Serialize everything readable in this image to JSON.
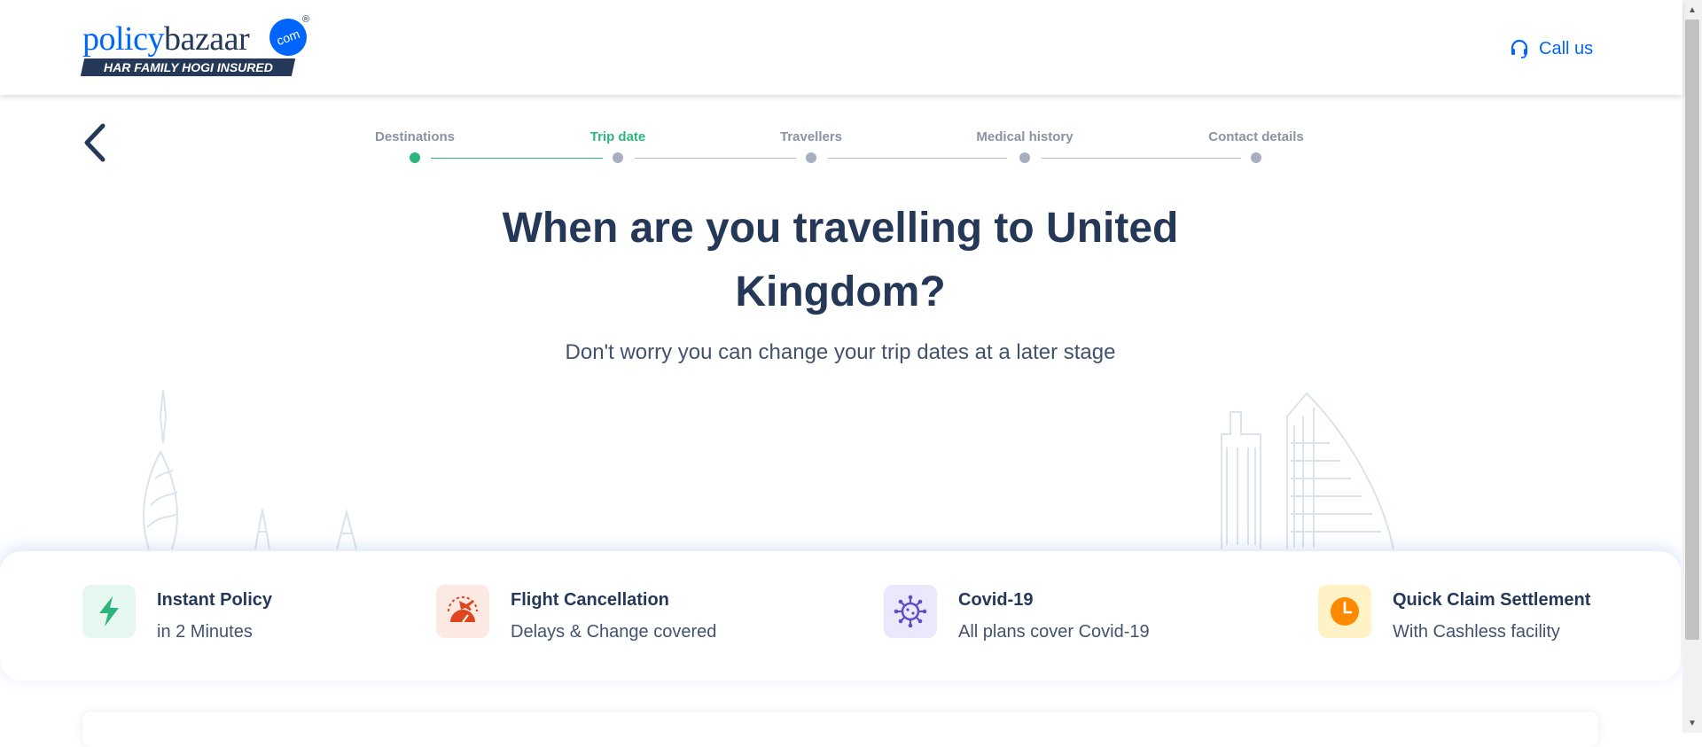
{
  "header": {
    "logo": {
      "part1": "policy",
      "part2": "bazaar",
      "badge": "com",
      "reg": "®",
      "tagline": "HAR FAMILY HOGI INSURED"
    },
    "call_us": {
      "label": "Call us",
      "icon": "headset-icon"
    }
  },
  "navigation": {
    "back_icon": "chevron-left-icon"
  },
  "stepper": {
    "steps": [
      {
        "label": "Destinations",
        "state": "done"
      },
      {
        "label": "Trip date",
        "state": "active"
      },
      {
        "label": "Travellers",
        "state": "pending"
      },
      {
        "label": "Medical history",
        "state": "pending"
      },
      {
        "label": "Contact details",
        "state": "pending"
      }
    ]
  },
  "main": {
    "title": "When are you travelling to United Kingdom?",
    "subtitle": "Don't worry you can change your trip dates at a later stage"
  },
  "features": [
    {
      "icon": "lightning-icon",
      "title": "Instant Policy",
      "subtitle": "in 2 Minutes",
      "bg": "#e6f7ef",
      "color": "#2cb67d"
    },
    {
      "icon": "flight-cancellation-icon",
      "title": "Flight Cancellation",
      "subtitle": "Delays & Change covered",
      "bg": "#fde9e4",
      "color": "#e0461d"
    },
    {
      "icon": "virus-icon",
      "title": "Covid-19",
      "subtitle": "All plans cover Covid-19",
      "bg": "#ece8fb",
      "color": "#5f4bc9"
    },
    {
      "icon": "clock-icon",
      "title": "Quick Claim Settlement",
      "subtitle": "With Cashless facility",
      "bg": "#fff2c6",
      "color": "#ff8a00"
    }
  ],
  "colors": {
    "brand_blue": "#0065ff",
    "navy": "#253858",
    "green": "#2cb67d"
  }
}
